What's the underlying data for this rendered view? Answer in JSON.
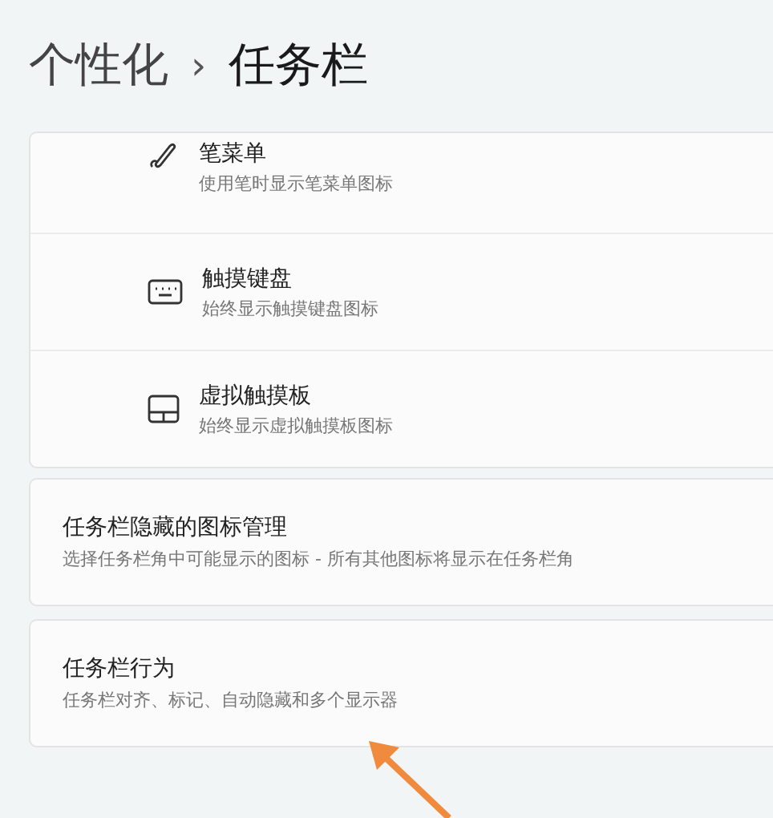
{
  "breadcrumb": {
    "parent": "个性化",
    "separator": "›",
    "current": "任务栏"
  },
  "corner_icons": [
    {
      "kind": "pen",
      "title": "笔菜单",
      "description": "使用笔时显示笔菜单图标"
    },
    {
      "kind": "keyboard",
      "title": "触摸键盘",
      "description": "始终显示触摸键盘图标"
    },
    {
      "kind": "touchpad",
      "title": "虚拟触摸板",
      "description": "始终显示虚拟触摸板图标"
    }
  ],
  "sections": [
    {
      "title": "任务栏隐藏的图标管理",
      "description": "选择任务栏角中可能显示的图标 - 所有其他图标将显示在任务栏角"
    },
    {
      "title": "任务栏行为",
      "description": "任务栏对齐、标记、自动隐藏和多个显示器"
    }
  ]
}
